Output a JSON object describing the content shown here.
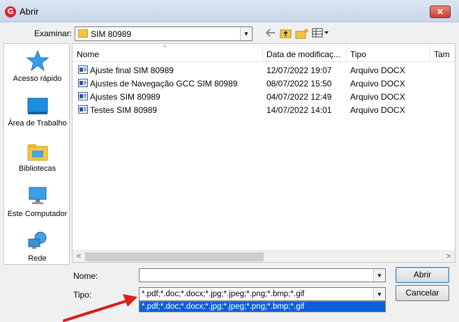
{
  "window": {
    "title": "Abrir",
    "logo_letter": "G",
    "close_glyph": "✕"
  },
  "lookin": {
    "label": "Examinar:",
    "value": "SIM 80989",
    "arrow": "▼"
  },
  "places": [
    {
      "label": "Acesso rápido"
    },
    {
      "label": "Área de Trabalho"
    },
    {
      "label": "Bibliotecas"
    },
    {
      "label": "Este Computador"
    },
    {
      "label": "Rede"
    }
  ],
  "columns": {
    "name": "Nome",
    "date": "Data de modificaç...",
    "type": "Tipo",
    "size": "Tam"
  },
  "files": [
    {
      "name": "Ajuste final SIM 80989",
      "date": "12/07/2022 19:07",
      "type": "Arquivo DOCX"
    },
    {
      "name": "Ajustes de Navegação GCC SIM 80989",
      "date": "08/07/2022 15:50",
      "type": "Arquivo DOCX"
    },
    {
      "name": "Ajustes SIM 80989",
      "date": "04/07/2022 12:49",
      "type": "Arquivo DOCX"
    },
    {
      "name": "Testes SIM 80989",
      "date": "14/07/2022 14:01",
      "type": "Arquivo DOCX"
    }
  ],
  "scroll": {
    "left": "<",
    "right": ">"
  },
  "form": {
    "name_label": "Nome:",
    "name_value": "",
    "type_label": "Tipo:",
    "type_value": "*.pdf;*.doc;*.docx;*.jpg;*.jpeg;*.png;*.bmp;*.gif",
    "dropdown_option": "*.pdf;*.doc;*.docx;*.jpg;*.jpeg;*.png;*.bmp;*.gif",
    "open_button": "Abrir",
    "cancel_button": "Cancelar"
  },
  "colors": {
    "selection": "#0a60d9",
    "arrow": "#d8201c"
  }
}
